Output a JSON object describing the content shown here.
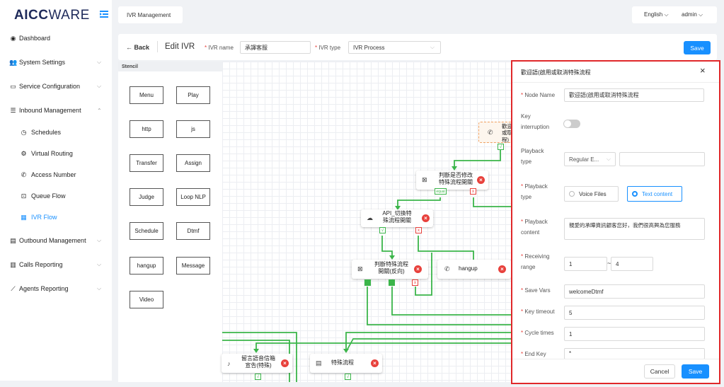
{
  "sidebar": {
    "logo_a": "AICC",
    "logo_b": "WARE",
    "items": [
      {
        "label": "Dashboard",
        "icon": "dashboard-icon"
      },
      {
        "label": "System Settings",
        "icon": "users-icon"
      },
      {
        "label": "Service Configuration",
        "icon": "id-card-icon"
      },
      {
        "label": "Inbound Management",
        "icon": "list-icon"
      },
      {
        "label": "Schedules",
        "icon": "clock-icon"
      },
      {
        "label": "Virtual Routing",
        "icon": "gear-icon"
      },
      {
        "label": "Access Number",
        "icon": "phone-icon"
      },
      {
        "label": "Queue Flow",
        "icon": "inbox-icon"
      },
      {
        "label": "IVR Flow",
        "icon": "grid-icon"
      },
      {
        "label": "Outbound Management",
        "icon": "table-icon"
      },
      {
        "label": "Calls Reporting",
        "icon": "bar-chart-icon"
      },
      {
        "label": "Agents Reporting",
        "icon": "line-chart-icon"
      }
    ]
  },
  "topbar": {
    "tab": "IVR Management",
    "language": "English",
    "user": "admin"
  },
  "header": {
    "back": "Back",
    "title": "Edit IVR",
    "ivr_name_label": "IVR name",
    "ivr_name_value": "承譯客服",
    "ivr_type_label": "IVR type",
    "ivr_type_value": "IVR Process",
    "save": "Save"
  },
  "stencil": {
    "title": "Stencil",
    "items": [
      "Menu",
      "Play",
      "http",
      "js",
      "Transfer",
      "Assign",
      "Judge",
      "Loop NLP",
      "Schedule",
      "Dtmf",
      "hangup",
      "Message",
      "Video"
    ]
  },
  "canvas": {
    "nodes": [
      {
        "text": "歡迎\n或取\n程)"
      },
      {
        "text": "判斷是否修改\n特殊流程開關"
      },
      {
        "text": "API_切換特\n殊流程開關"
      },
      {
        "text": "判斷特殊流程\n開關(反向)"
      },
      {
        "text": "hangup"
      },
      {
        "text": "留言語音信箱\n宣告(特殊)"
      },
      {
        "text": "特殊流程"
      }
    ],
    "ports": {
      "check": "√",
      "cross": "x",
      "equal": "equal"
    }
  },
  "panel": {
    "title": "歡迎語(啟用或取消特殊流程",
    "close": "×",
    "node_name_label": "Node Name",
    "node_name_value": "歡迎語(啟用或取消特殊流程",
    "key_interruption_label_a": "Key",
    "key_interruption_label_b": "interruption",
    "playback_type_label_a": "Playback",
    "playback_type_label_b": "type",
    "playback_type_select": "Regular E...",
    "playback_type2_label_a": "Playback",
    "playback_type2_label_b": "type",
    "radio_voice": "Voice Files",
    "radio_text": "Text content",
    "playback_content_label_a": "Playback",
    "playback_content_label_b": "content",
    "playback_content_value": "親愛的承曄資訊顧客您好，我們很高興為您服務",
    "receiving_label_a": "Receiving",
    "receiving_label_b": "range",
    "receiving_from": "1",
    "receiving_sep": "~",
    "receiving_to": "4",
    "save_vars_label": "Save Vars",
    "save_vars_value": "welcomeDtmf",
    "key_timeout_label": "Key timeout",
    "key_timeout_value": "5",
    "cycle_times_label": "Cycle times",
    "cycle_times_value": "1",
    "end_key_label": "End Key",
    "end_key_value": "*",
    "cancel": "Cancel",
    "save": "Save"
  }
}
